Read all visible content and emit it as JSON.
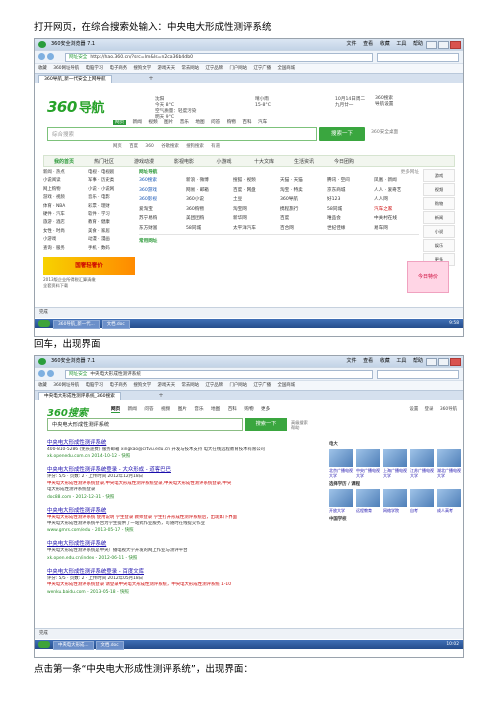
{
  "doc": {
    "para1": "打开网页，在综合搜索处输入：中央电大形成性测评系统",
    "para2": "回车，出现界面",
    "para3": "点击第一条“中央电大形成性测评系统”，出现界面："
  },
  "shot1": {
    "window_title": "360安全浏览器 7.1",
    "menu": [
      "文件",
      "查看",
      "收藏",
      "工具",
      "帮助"
    ],
    "url": "http://hao.360.cn/?src=lm&ls=n2ca36b4db0",
    "safe_label": "网址安全",
    "favorites": [
      "收藏",
      "360网址导航",
      "电脑学习",
      "电子商务",
      "搜狗文学",
      "游戏天天",
      "常去网站",
      "辽宁品牌",
      "门户网站",
      "辽宁广播",
      "全国商城"
    ],
    "tab_label": "360导航_新一代安全上网导航",
    "logo_text": "360",
    "logo_cn": "导航",
    "weather": [
      "沈阳",
      "今天 8°C",
      "空气质量：轻度污染",
      "明天 9°C"
    ],
    "weather2": [
      "晴小雨",
      "15-8°C"
    ],
    "date": [
      "10月14日周二",
      "九月廿一"
    ],
    "topright": [
      "360搜索",
      "导航设置"
    ],
    "search_cats": [
      "网页",
      "新闻",
      "视频",
      "图片",
      "音乐",
      "地图",
      "问答",
      "购物",
      "百科",
      "汽车"
    ],
    "search_placeholder": "综合搜索",
    "search_button": "搜索一下",
    "engines": [
      "网页",
      "百度",
      "360",
      "谷歌搜索",
      "搜狗搜索",
      "有道"
    ],
    "hot_label": "360安全桌面",
    "navrow": [
      "我的首页",
      "热门社区",
      "游戏动漫",
      "影视电影",
      "小游戏",
      "十大文库",
      "生活资讯",
      "今日团购"
    ],
    "left_rows": [
      [
        "新闻 · 热点",
        "电视 · 电视剧"
      ],
      [
        "小说阅读",
        "军事 · 历史类"
      ],
      [
        "网上购物",
        "小说 · 小说网"
      ],
      [
        "游戏 · 视频",
        "音乐 · 电影"
      ],
      [
        "体育 · NBA",
        "彩票 · 理财"
      ],
      [
        "硬件 · 汽车",
        "软件 · 学习"
      ],
      [
        "旅游 · 酒店",
        "教育 · 健康"
      ],
      [
        "女性 · 时尚",
        "美食 · 家居"
      ],
      [
        "小游戏",
        "动漫 · 漫画"
      ],
      [
        "查询 · 服务",
        "手机 · 数码"
      ]
    ],
    "ad_text": "国奢轻奢价",
    "left_tail": [
      "2013版企业所得税汇算清缴",
      "全套资料下载"
    ],
    "mid_title": "网址导航",
    "mid_more": "更多网址",
    "mid_grid": [
      "360搜索",
      "新浪 · 微博",
      "搜狐 · 视频",
      "天猫 · 天猫",
      "腾讯 · 空间",
      "凤凰 · 新闻",
      "360游戏",
      "网易 · 邮箱",
      "百度 · 网盘",
      "淘宝 · 特卖",
      "京东商城",
      "人人 · 爱奇艺",
      "360影视",
      "360小说",
      "土豆",
      "360导航",
      "好123",
      "人人网",
      "爱淘宝",
      "360购物",
      "淘宝网",
      "携程旅行",
      "58同城",
      "汽车之家",
      "苏宁易购",
      "美团团购",
      "新华网",
      "百度",
      "唯品会",
      "中关村在线",
      "东方财富",
      "58同城",
      "太平洋汽车",
      "百合网",
      "世纪佳缘",
      "易车网"
    ],
    "mid_tail": "常用网址",
    "right_links": [
      "游戏",
      "视频",
      "购物",
      "新闻",
      "小说",
      "娱乐",
      "更多"
    ],
    "pink_ad": "今日特价",
    "status_text": "完成",
    "taskbar": [
      "360导航_新一代...",
      "文档.doc"
    ],
    "clock": "9:58"
  },
  "shot2": {
    "window_title": "360安全浏览器 7.1",
    "url": "中央电大形成性测评系统",
    "tab_label": "中央电大形成性测评系统_360搜索",
    "logo_text": "360搜索",
    "tabs": [
      "网页",
      "新闻",
      "问答",
      "视频",
      "图片",
      "音乐",
      "地图",
      "百科",
      "购物",
      "更多"
    ],
    "topright": [
      "设置",
      "登录",
      "360导航"
    ],
    "query": "中央电大形成性测评系统",
    "search_button": "搜索一下",
    "adv": [
      "高级搜索",
      "帮助"
    ],
    "results": [
      {
        "title": "中央电大形成性测评系统",
        "lines": [
          "400-810-5286 (免长途费) 服务邮箱 xingkao@crtvu.edu.cn 开发与技术支持 电大在线远程教育技术有限公司"
        ],
        "url": "xk.openedu.com.cn 2014-10-12 - 快照"
      },
      {
        "title": "中央电大形成性测评系统登录 - 大众形成 - 道客巴巴",
        "lines": [
          "评分: 5/5 · 页数: 2 · 上传时间 2012年12月18日",
          "中央电大形成性测评系统登录,中央电大形成性测评系统登录,中央电大形成性测评系统登录,中央",
          "电大形成性测评系统登录"
        ],
        "url": "doc88.com - 2012-12-31 - 快照"
      },
      {
        "title": "中央电大形成性测评系统",
        "lines": [
          "中央电大形成性测评系统 使用说明 学生登录 教师登录 学生打开形成性测评系统后，出现如下界面",
          "中央电大形成性测评系统平台为学生提供了一站式作业服务，可随时在线提交作业"
        ],
        "url": "www.gmrs.com/edu - 2013-05-17 - 快照"
      },
      {
        "title": "中央电大形成性测评系统",
        "lines": [
          "中央电大形成性测评系统是中央广播电视大学开发的网上作业与测评平台"
        ],
        "url": "xk.open.edu.cn/index - 2012-06-11 - 快照"
      },
      {
        "title": "中央电大形成性测评系统登录 - 百度文库",
        "lines": [
          "评分: 5/5 · 页数: 2 · 上传时间 2012年05月18日",
          "中央电大形成性测评系统登录 请登录中央电大形成性测评系统，中央电大形成性测评系统 1-10"
        ],
        "url": "wenku.baidu.com - 2013-05-18 - 快照"
      }
    ],
    "side_header": "电大",
    "side_cards1": [
      "北京广播电视大学",
      "中央广播电视大学",
      "上海广播电视大学",
      "江苏广播电视大学",
      "湖北广播电视大学"
    ],
    "side_label2": "选择学历 / 课程",
    "side_cards2": [
      "开放大学",
      "远程教育",
      "网络学院",
      "自考",
      "成人高考"
    ],
    "side_label3": "中国学校",
    "status_text": "完成",
    "taskbar": [
      "中央电大形成...",
      "文档.doc"
    ],
    "clock": "10:02"
  }
}
